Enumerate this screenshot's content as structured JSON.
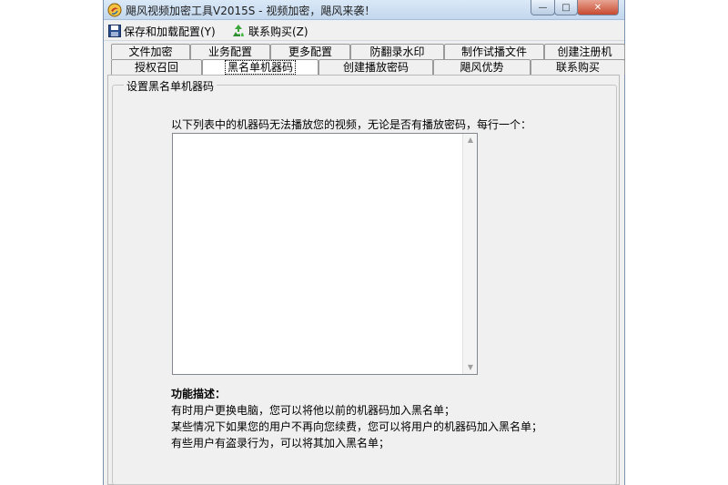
{
  "window": {
    "title": "飓风视频加密工具V2015S - 视频加密，飓风来袭！",
    "app_icon": "hurricane-logo-icon",
    "controls": {
      "minimize": "—",
      "maximize": "□",
      "close": "✕"
    }
  },
  "toolbar": {
    "save_label": "保存和加载配置(Y)",
    "buy_label": "联系购买(Z)",
    "save_icon": "floppy-disk-icon",
    "buy_icon": "recycle-icon"
  },
  "tabs": {
    "row1": [
      "文件加密",
      "业务配置",
      "更多配置",
      "防翻录水印",
      "制作试播文件",
      "创建注册机"
    ],
    "row2": [
      "授权召回",
      "黑名单机器码",
      "创建播放密码",
      "飓风优势",
      "联系购买"
    ],
    "active": "黑名单机器码"
  },
  "group": {
    "title": "设置黑名单机器码",
    "instruction": "以下列表中的机器码无法播放您的视频，无论是否有播放密码，每行一个：",
    "list_value": ""
  },
  "description": {
    "title": "功能描述：",
    "lines": [
      "有时用户更换电脑，您可以将他以前的机器码加入黑名单；",
      "某些情况下如果您的用户不再向您续费，您可以将用户的机器码加入黑名单；",
      "有些用户有盗录行为，可以将其加入黑名单；"
    ]
  }
}
